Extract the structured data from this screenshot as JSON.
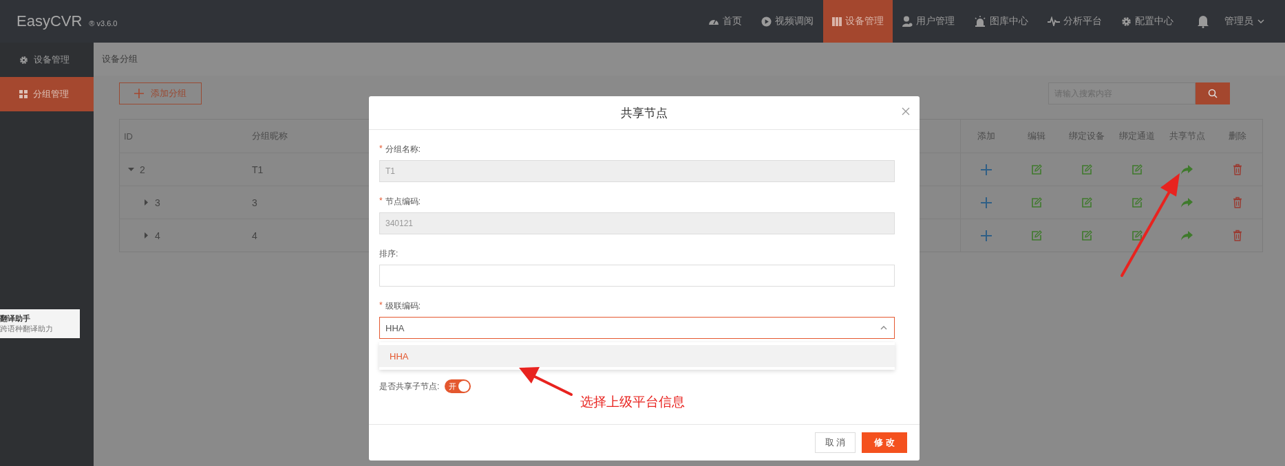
{
  "header": {
    "logo": "EasyCVR",
    "version": "® v3.6.0",
    "user": "管理员",
    "nav": [
      {
        "label": "首页",
        "kind": "gauge",
        "selected": false
      },
      {
        "label": "视频调阅",
        "kind": "play",
        "selected": false
      },
      {
        "label": "设备管理",
        "kind": "book",
        "selected": true
      },
      {
        "label": "用户管理",
        "kind": "user",
        "selected": false
      },
      {
        "label": "图库中心",
        "kind": "alarm",
        "selected": false
      },
      {
        "label": "分析平台",
        "kind": "pulse",
        "selected": false
      },
      {
        "label": "配置中心",
        "kind": "gear",
        "selected": false
      }
    ]
  },
  "sidebar": {
    "items": [
      {
        "label": "设备管理",
        "kind": "gear",
        "selected": false
      },
      {
        "label": "分组管理",
        "kind": "grid",
        "selected": true
      }
    ]
  },
  "breadcrumb": "设备分组",
  "toolbar": {
    "add_button": "添加分组",
    "search": {
      "placeholder": "请输入搜索内容"
    }
  },
  "table": {
    "columns": [
      {
        "label": "ID",
        "kind": "id"
      },
      {
        "label": "分组昵称",
        "kind": "name"
      },
      {
        "label": "添加",
        "kind": "add"
      },
      {
        "label": "编辑",
        "kind": "edit"
      },
      {
        "label": "绑定设备",
        "kind": "edit"
      },
      {
        "label": "绑定通道",
        "kind": "edit"
      },
      {
        "label": "共享节点",
        "kind": "share"
      },
      {
        "label": "删除",
        "kind": "delete"
      }
    ],
    "rows": [
      {
        "id": "2",
        "name": "T1",
        "expanded": true,
        "children": [
          {
            "id": "3",
            "name": "3",
            "expanded": false
          },
          {
            "id": "4",
            "name": "4",
            "expanded": false
          }
        ]
      }
    ]
  },
  "translate_popup": {
    "title": "翻译助手",
    "subtitle": "跨语种翻译助力"
  },
  "dialog": {
    "title": "共享节点",
    "fields": [
      {
        "kind": "input",
        "mark": "*",
        "label": "分组名称:",
        "value": "T1",
        "disabled": true
      },
      {
        "kind": "input",
        "mark": "*",
        "label": "节点编码:",
        "value": "340121",
        "disabled": true
      },
      {
        "kind": "input",
        "label": "排序:",
        "disabled": false
      },
      {
        "kind": "select",
        "mark": "*",
        "label": "级联编码:",
        "value": "HHA",
        "expanded": true,
        "options": [
          {
            "label": "HHA",
            "selected": true
          }
        ]
      },
      {
        "kind": "switch",
        "label": "是否共享子节点:",
        "on": true,
        "text": "开"
      }
    ],
    "buttons": [
      {
        "label": "取 消",
        "kind": "cancel"
      },
      {
        "label": "修 改",
        "kind": "primary"
      }
    ]
  },
  "annotation": {
    "text": "选择上级平台信息"
  }
}
